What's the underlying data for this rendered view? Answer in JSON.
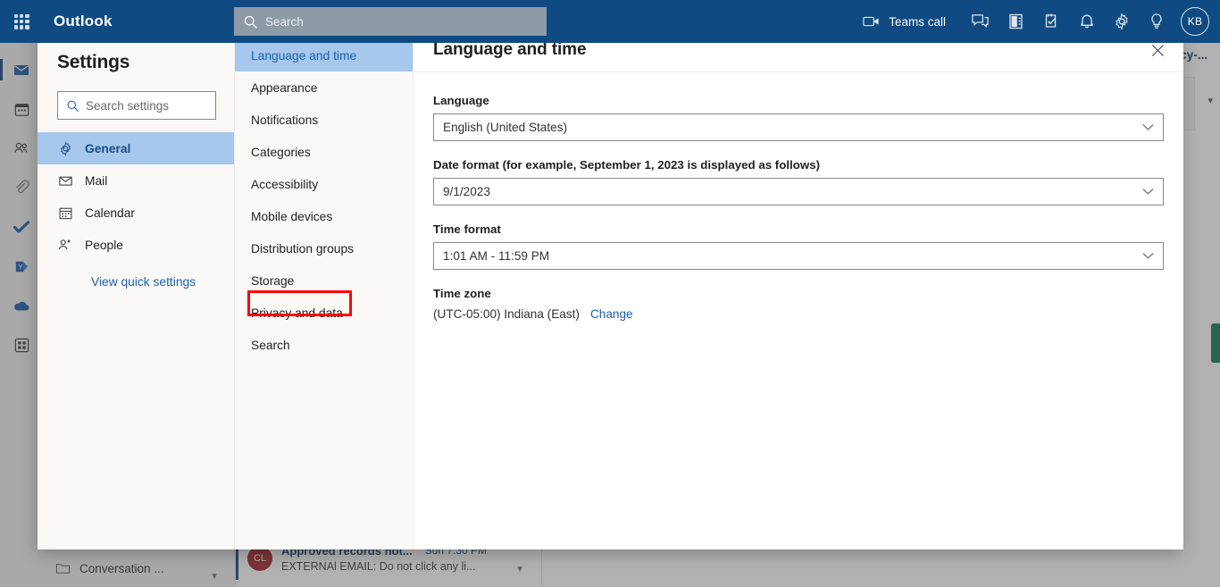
{
  "suitebar": {
    "waffle_label": "app-launcher",
    "brand": "Outlook",
    "search_placeholder": "Search",
    "search_value": "",
    "teams_call_label": "Teams call",
    "avatar_initials": "KB"
  },
  "background": {
    "folder_label": "Conversation ...",
    "message": {
      "avatar_initials": "CL",
      "subject": "Approved records not...",
      "date": "Sun 7:30 PM",
      "preview": "EXTERNAl EMAIL: Do not click any li..."
    },
    "reading_subject": "licy-..."
  },
  "dialog": {
    "title": "Settings",
    "search": {
      "placeholder": "Search settings",
      "value": ""
    },
    "nav": [
      {
        "label": "General",
        "icon": "gear-icon",
        "active": true
      },
      {
        "label": "Mail",
        "icon": "mail-icon",
        "active": false
      },
      {
        "label": "Calendar",
        "icon": "calendar-icon",
        "active": false
      },
      {
        "label": "People",
        "icon": "people-icon",
        "active": false
      }
    ],
    "quick_settings_link": "View quick settings",
    "categories": [
      {
        "label": "Language and time",
        "active": true
      },
      {
        "label": "Appearance",
        "active": false
      },
      {
        "label": "Notifications",
        "active": false
      },
      {
        "label": "Categories",
        "active": false
      },
      {
        "label": "Accessibility",
        "active": false
      },
      {
        "label": "Mobile devices",
        "active": false
      },
      {
        "label": "Distribution groups",
        "active": false
      },
      {
        "label": "Storage",
        "active": false
      },
      {
        "label": "Privacy and data",
        "active": false,
        "highlighted": true
      },
      {
        "label": "Search",
        "active": false
      }
    ],
    "highlight_color": "#ff0000",
    "panel": {
      "title": "Language and time",
      "close_label": "Close",
      "language": {
        "label": "Language",
        "value": "English (United States)"
      },
      "date_format": {
        "label": "Date format (for example, September 1, 2023 is displayed as follows)",
        "value": "9/1/2023"
      },
      "time_format": {
        "label": "Time format",
        "value": "1:01 AM - 11:59 PM"
      },
      "time_zone": {
        "label": "Time zone",
        "value": "(UTC-05:00) Indiana (East)",
        "change_label": "Change"
      }
    }
  },
  "colors": {
    "suitebar_bg": "#0f4b82",
    "accent": "#1b5faa",
    "selection": "#a6c8ec",
    "highlight": "#ff0000"
  }
}
